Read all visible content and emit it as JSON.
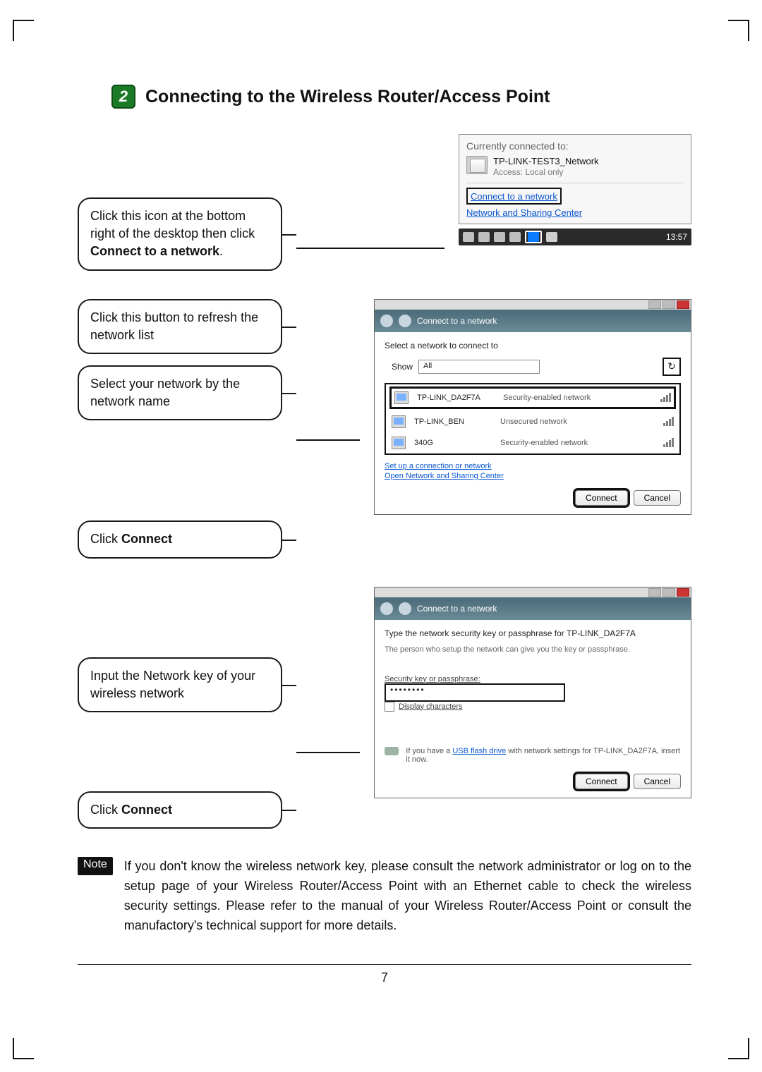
{
  "page_number": "7",
  "section": {
    "step_number": "2",
    "title": "Connecting to the Wireless Router/Access Point"
  },
  "row1": {
    "callout_pre": "Click this icon at the bottom right of the desktop then click ",
    "callout_bold": "Connect to a network",
    "popup": {
      "header": "Currently connected to:",
      "network_name": "TP-LINK-TEST3_Network",
      "access_label": "Access:  Local only",
      "link1": "Connect to a network",
      "link2": "Network and Sharing Center",
      "clock": "13:57"
    }
  },
  "row2": {
    "callout1": "Click this button to refresh the network list",
    "callout2": "Select your network by the network name",
    "callout3_pre": "Click ",
    "callout3_bold": "Connect",
    "dialog": {
      "title": "Connect to a network",
      "prompt": "Select a network to connect to",
      "show_label": "Show",
      "show_value": "All",
      "refresh_glyph": "↻",
      "items": [
        {
          "name": "TP-LINK_DA2F7A",
          "sec": "Security-enabled network"
        },
        {
          "name": "TP-LINK_BEN",
          "sec": "Unsecured network"
        },
        {
          "name": "340G",
          "sec": "Security-enabled network"
        }
      ],
      "link1": "Set up a connection or network",
      "link2": "Open Network and Sharing Center",
      "btn_connect": "Connect",
      "btn_cancel": "Cancel"
    }
  },
  "row3": {
    "callout1": "Input the Network key of your wireless network",
    "callout2_pre": "Click ",
    "callout2_bold": "Connect",
    "dialog": {
      "title": "Connect to a network",
      "line1": "Type the network security key or passphrase for TP-LINK_DA2F7A",
      "line2": "The person who setup the network can give you the key or passphrase.",
      "sec_label": "Security key or passphrase:",
      "sec_value": "••••••••",
      "display_chars": "Display characters",
      "usb_pre": "If you have a ",
      "usb_link": "USB flash drive",
      "usb_post": " with network settings for TP-LINK_DA2F7A, insert it now.",
      "btn_connect": "Connect",
      "btn_cancel": "Cancel"
    }
  },
  "note": {
    "label": "Note",
    "text": "If you don't know the wireless network key, please consult the network administrator or log on to the setup page of your Wireless Router/Access Point with an Ethernet cable to check the wireless security settings. Please refer to the manual of your Wireless Router/Access Point or consult the manufactory's technical support for more details."
  }
}
